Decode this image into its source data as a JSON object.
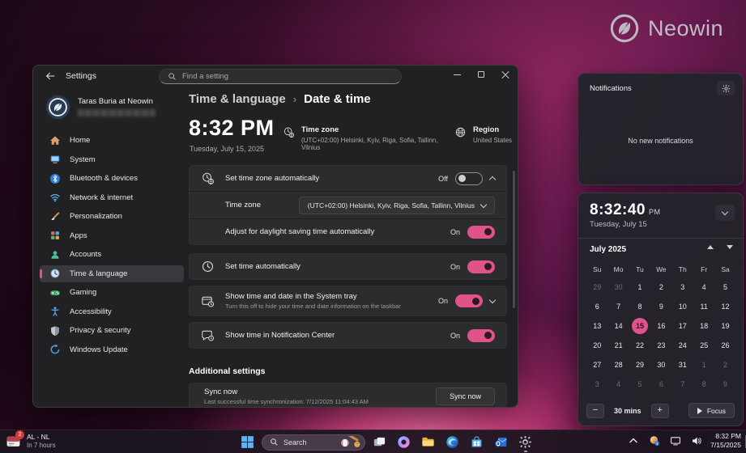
{
  "colors": {
    "accent": "#e0538a"
  },
  "brand": {
    "name": "Neowin"
  },
  "settings_window": {
    "title": "Settings",
    "search_placeholder": "Find a setting",
    "user": {
      "name": "Taras Buria at Neowin"
    },
    "sidebar": [
      {
        "label": "Home",
        "icon": "home-icon"
      },
      {
        "label": "System",
        "icon": "system-icon"
      },
      {
        "label": "Bluetooth & devices",
        "icon": "bluetooth-icon"
      },
      {
        "label": "Network & internet",
        "icon": "network-icon"
      },
      {
        "label": "Personalization",
        "icon": "personalization-icon"
      },
      {
        "label": "Apps",
        "icon": "apps-icon"
      },
      {
        "label": "Accounts",
        "icon": "accounts-icon"
      },
      {
        "label": "Time & language",
        "icon": "time-language-icon",
        "selected": true
      },
      {
        "label": "Gaming",
        "icon": "gaming-icon"
      },
      {
        "label": "Accessibility",
        "icon": "accessibility-icon"
      },
      {
        "label": "Privacy & security",
        "icon": "privacy-icon"
      },
      {
        "label": "Windows Update",
        "icon": "windows-update-icon"
      }
    ],
    "breadcrumb": {
      "parent": "Time & language",
      "separator": "›",
      "current": "Date & time"
    },
    "hero": {
      "time": "8:32 PM",
      "date": "Tuesday, July 15, 2025",
      "timezone_label": "Time zone",
      "timezone_value": "(UTC+02:00) Helsinki, Kyiv, Riga, Sofia, Tallinn, Vilnius",
      "region_label": "Region",
      "region_value": "United States"
    },
    "cards": {
      "tz_auto": {
        "title": "Set time zone automatically",
        "state": "Off"
      },
      "tz_row": {
        "label": "Time zone",
        "value": "(UTC+02:00) Helsinki, Kyiv, Riga, Sofia, Tallinn, Vilnius"
      },
      "dst": {
        "title": "Adjust for daylight saving time automatically",
        "state": "On"
      },
      "time_auto": {
        "title": "Set time automatically",
        "state": "On"
      },
      "systray": {
        "title": "Show time and date in the System tray",
        "subtitle": "Turn this off to hide your time and date information on the taskbar",
        "state": "On"
      },
      "notif_center": {
        "title": "Show time in Notification Center",
        "state": "On"
      }
    },
    "additional": {
      "heading": "Additional settings",
      "sync_title": "Sync now",
      "sync_subtitle": "Last successful time synchronization: 7/12/2025 11:04:43 AM",
      "sync_button": "Sync now"
    }
  },
  "notifications_panel": {
    "title": "Notifications",
    "empty": "No new notifications"
  },
  "clock_panel": {
    "time": "8:32:40",
    "meridiem": "PM",
    "date": "Tuesday, July 15",
    "calendar": {
      "month": "July 2025",
      "day_headers": [
        "Su",
        "Mo",
        "Tu",
        "We",
        "Th",
        "Fr",
        "Sa"
      ],
      "weeks": [
        [
          {
            "d": 29,
            "dim": true
          },
          {
            "d": 30,
            "dim": true
          },
          {
            "d": 1
          },
          {
            "d": 2
          },
          {
            "d": 3
          },
          {
            "d": 4
          },
          {
            "d": 5
          }
        ],
        [
          {
            "d": 6
          },
          {
            "d": 7
          },
          {
            "d": 8
          },
          {
            "d": 9
          },
          {
            "d": 10
          },
          {
            "d": 11
          },
          {
            "d": 12
          }
        ],
        [
          {
            "d": 13
          },
          {
            "d": 14
          },
          {
            "d": 15,
            "selected": true
          },
          {
            "d": 16
          },
          {
            "d": 17
          },
          {
            "d": 18
          },
          {
            "d": 19
          }
        ],
        [
          {
            "d": 20
          },
          {
            "d": 21
          },
          {
            "d": 22
          },
          {
            "d": 23
          },
          {
            "d": 24
          },
          {
            "d": 25
          },
          {
            "d": 26
          }
        ],
        [
          {
            "d": 27
          },
          {
            "d": 28
          },
          {
            "d": 29
          },
          {
            "d": 30
          },
          {
            "d": 31
          },
          {
            "d": 1,
            "dim": true
          },
          {
            "d": 2,
            "dim": true
          }
        ],
        [
          {
            "d": 3,
            "dim": true
          },
          {
            "d": 4,
            "dim": true
          },
          {
            "d": 5,
            "dim": true
          },
          {
            "d": 6,
            "dim": true
          },
          {
            "d": 7,
            "dim": true
          },
          {
            "d": 8,
            "dim": true
          },
          {
            "d": 9,
            "dim": true
          }
        ]
      ]
    },
    "focus": {
      "duration": "30 mins",
      "label": "Focus"
    }
  },
  "taskbar": {
    "widget": {
      "badge": "2",
      "line1": "AL - NL",
      "line2": "In 7 hours"
    },
    "search_label": "Search",
    "apps": [
      {
        "icon": "task-view-icon",
        "name": "task-view-button"
      },
      {
        "icon": "copilot-icon",
        "name": "copilot-button"
      },
      {
        "icon": "file-explorer-icon",
        "name": "file-explorer-button"
      },
      {
        "icon": "edge-icon",
        "name": "edge-button"
      },
      {
        "icon": "store-icon",
        "name": "microsoft-store-button"
      },
      {
        "icon": "outlook-icon",
        "name": "outlook-button"
      },
      {
        "icon": "gear-icon",
        "name": "settings-button",
        "running": true
      }
    ],
    "tray_icons": [
      {
        "icon": "chevron-up-icon",
        "name": "tray-overflow-button"
      },
      {
        "icon": "tray-color-icon",
        "name": "tray-app-icon"
      },
      {
        "icon": "monitor-icon",
        "name": "network-tray-icon"
      },
      {
        "icon": "volume-icon",
        "name": "volume-tray-icon"
      }
    ],
    "clock": {
      "time": "8:32 PM",
      "date": "7/15/2025"
    }
  }
}
